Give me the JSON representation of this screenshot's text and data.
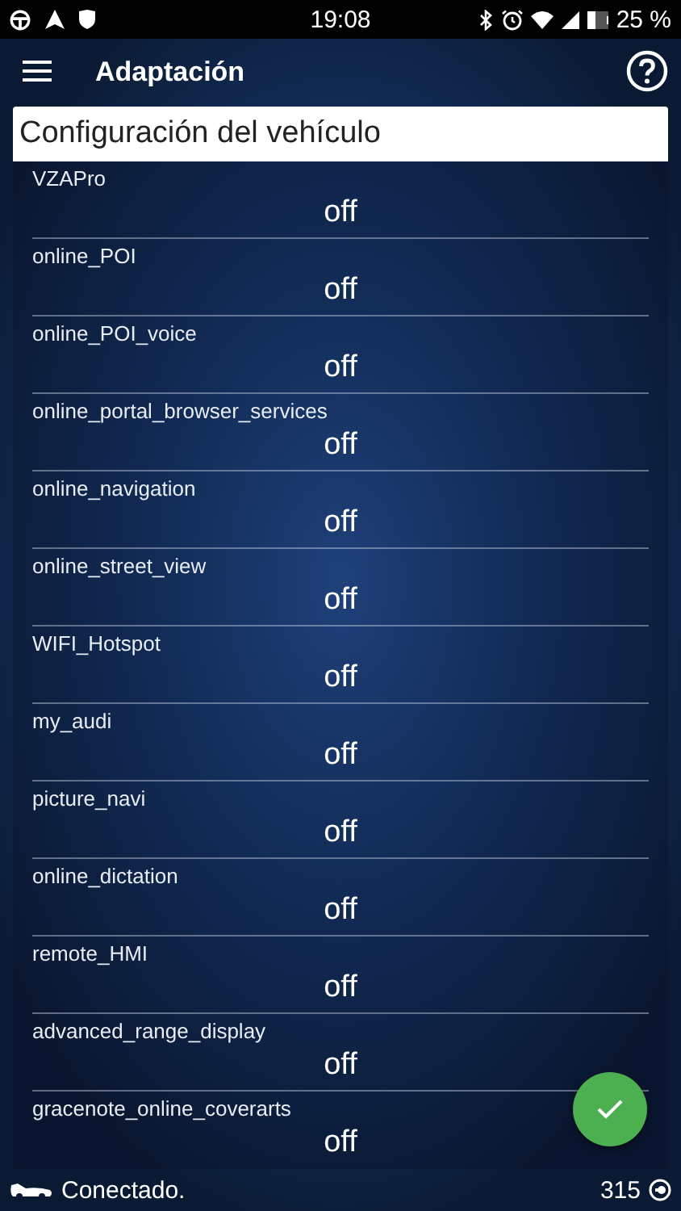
{
  "status_bar": {
    "time": "19:08",
    "battery": "25 %"
  },
  "app_bar": {
    "title": "Adaptación"
  },
  "card": {
    "title": "Configuración del vehículo"
  },
  "settings": [
    {
      "name": "VZAPro",
      "value": "off"
    },
    {
      "name": "online_POI",
      "value": "off"
    },
    {
      "name": "online_POI_voice",
      "value": "off"
    },
    {
      "name": "online_portal_browser_services",
      "value": "off"
    },
    {
      "name": "online_navigation",
      "value": "off"
    },
    {
      "name": "online_street_view",
      "value": "off"
    },
    {
      "name": "WIFI_Hotspot",
      "value": "off"
    },
    {
      "name": "my_audi",
      "value": "off"
    },
    {
      "name": "picture_navi",
      "value": "off"
    },
    {
      "name": "online_dictation",
      "value": "off"
    },
    {
      "name": "remote_HMI",
      "value": "off"
    },
    {
      "name": "advanced_range_display",
      "value": "off"
    },
    {
      "name": "gracenote_online_coverarts",
      "value": "off"
    }
  ],
  "footer": {
    "status": "Conectado.",
    "count": "315"
  }
}
